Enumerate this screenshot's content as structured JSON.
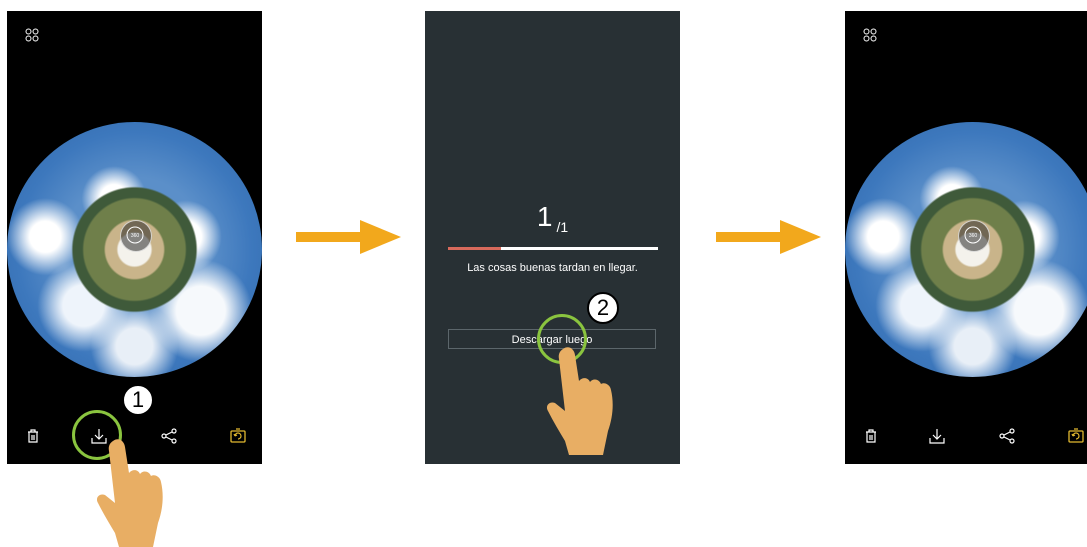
{
  "screen1": {
    "icons": [
      "grid-icon",
      "trash-icon",
      "download-icon",
      "share-icon",
      "switch-camera-icon"
    ],
    "center_badge": "360"
  },
  "screen2": {
    "counter_current": "1",
    "counter_total": "/1",
    "progress": 0.25,
    "message": "Las cosas buenas tardan en llegar.",
    "later_button": "Descargar luego"
  },
  "screen3": {
    "icons": [
      "grid-icon",
      "trash-icon",
      "download-icon",
      "share-icon",
      "switch-camera-icon"
    ],
    "center_badge": "360"
  },
  "steps": {
    "step1": "1",
    "step2": "2"
  },
  "colors": {
    "accent_yellow": "#e2b930",
    "tap_green": "#8ac43f",
    "arrow_orange": "#f2a81c",
    "progress_red": "#d86a5c",
    "dialog_bg": "#283034"
  }
}
